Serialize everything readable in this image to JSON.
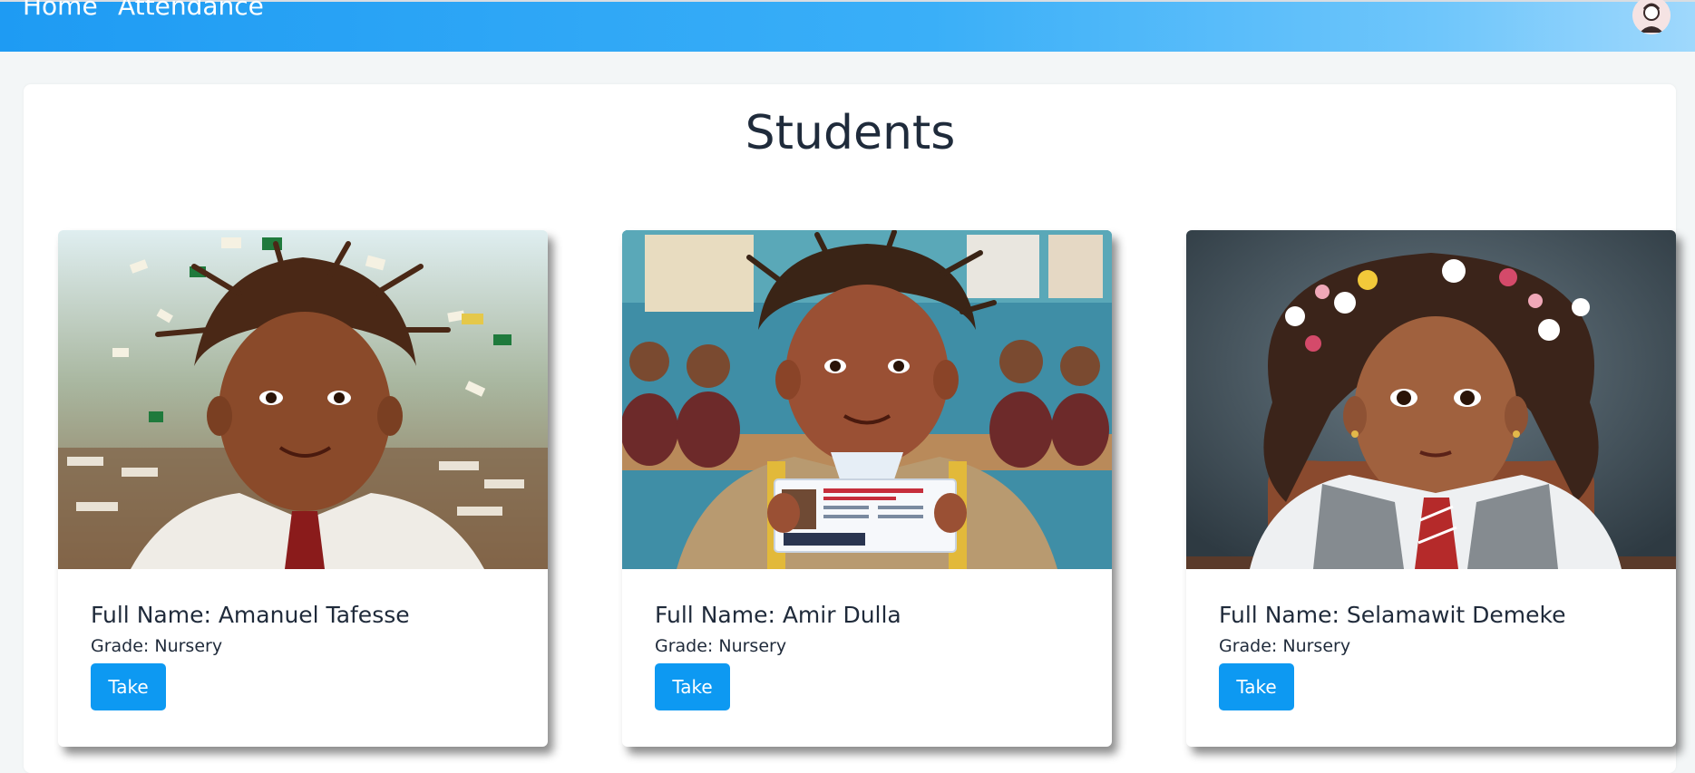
{
  "nav": {
    "home_label": "Home",
    "attendance_label": "Attendance",
    "avatar_icon": "user-avatar-icon"
  },
  "page": {
    "title": "Students"
  },
  "students": [
    {
      "full_name": "Full Name: Amanuel Tafesse",
      "grade": "Grade: Nursery",
      "action_label": "Take",
      "photo": "student-photo"
    },
    {
      "full_name": "Full Name: Amir Dulla",
      "grade": "Grade: Nursery",
      "action_label": "Take",
      "photo": "student-photo"
    },
    {
      "full_name": "Full Name: Selamawit Demeke",
      "grade": "Grade: Nursery",
      "action_label": "Take",
      "photo": "student-photo"
    }
  ],
  "colors": {
    "navbar_start": "#1e9bf3",
    "navbar_end": "#9fd8fc",
    "button": "#0d99f2",
    "background": "#f3f6f7"
  }
}
